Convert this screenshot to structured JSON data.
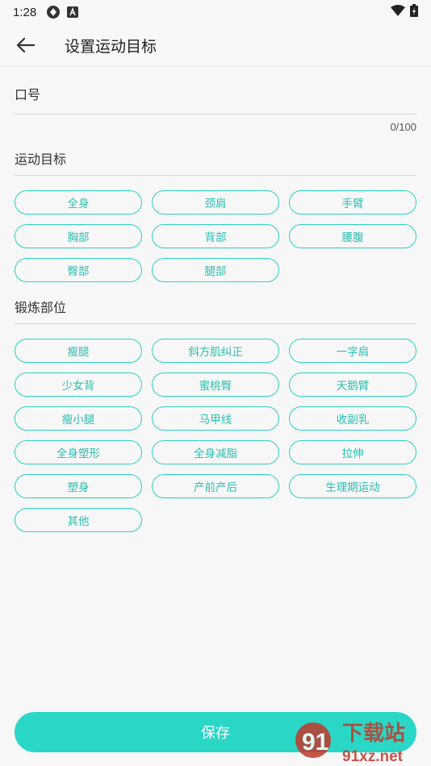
{
  "status_bar": {
    "time": "1:28"
  },
  "app_bar": {
    "title": "设置运动目标"
  },
  "slogan": {
    "label": "口号",
    "value": "",
    "placeholder": "",
    "counter": "0/100"
  },
  "goals": {
    "title": "运动目标",
    "items": [
      "全身",
      "颈肩",
      "手臂",
      "胸部",
      "背部",
      "腰腹",
      "臀部",
      "腿部"
    ]
  },
  "body_parts": {
    "title": "锻炼部位",
    "items": [
      "瘦腿",
      "斜方肌纠正",
      "一字肩",
      "少女背",
      "蜜桃臀",
      "天鹅臂",
      "瘦小腿",
      "马甲线",
      "收副乳",
      "全身塑形",
      "全身减脂",
      "拉伸",
      "塑身",
      "产前产后",
      "生理期运动",
      "其他"
    ]
  },
  "footer": {
    "save_label": "保存"
  },
  "watermark": {
    "brand": "下载站",
    "domain": "91xz.net",
    "number": "91"
  },
  "colors": {
    "accent": "#2ad1c0",
    "button": "#2ad7c6",
    "background": "#f7f7f8",
    "watermark": "#c0392b"
  }
}
